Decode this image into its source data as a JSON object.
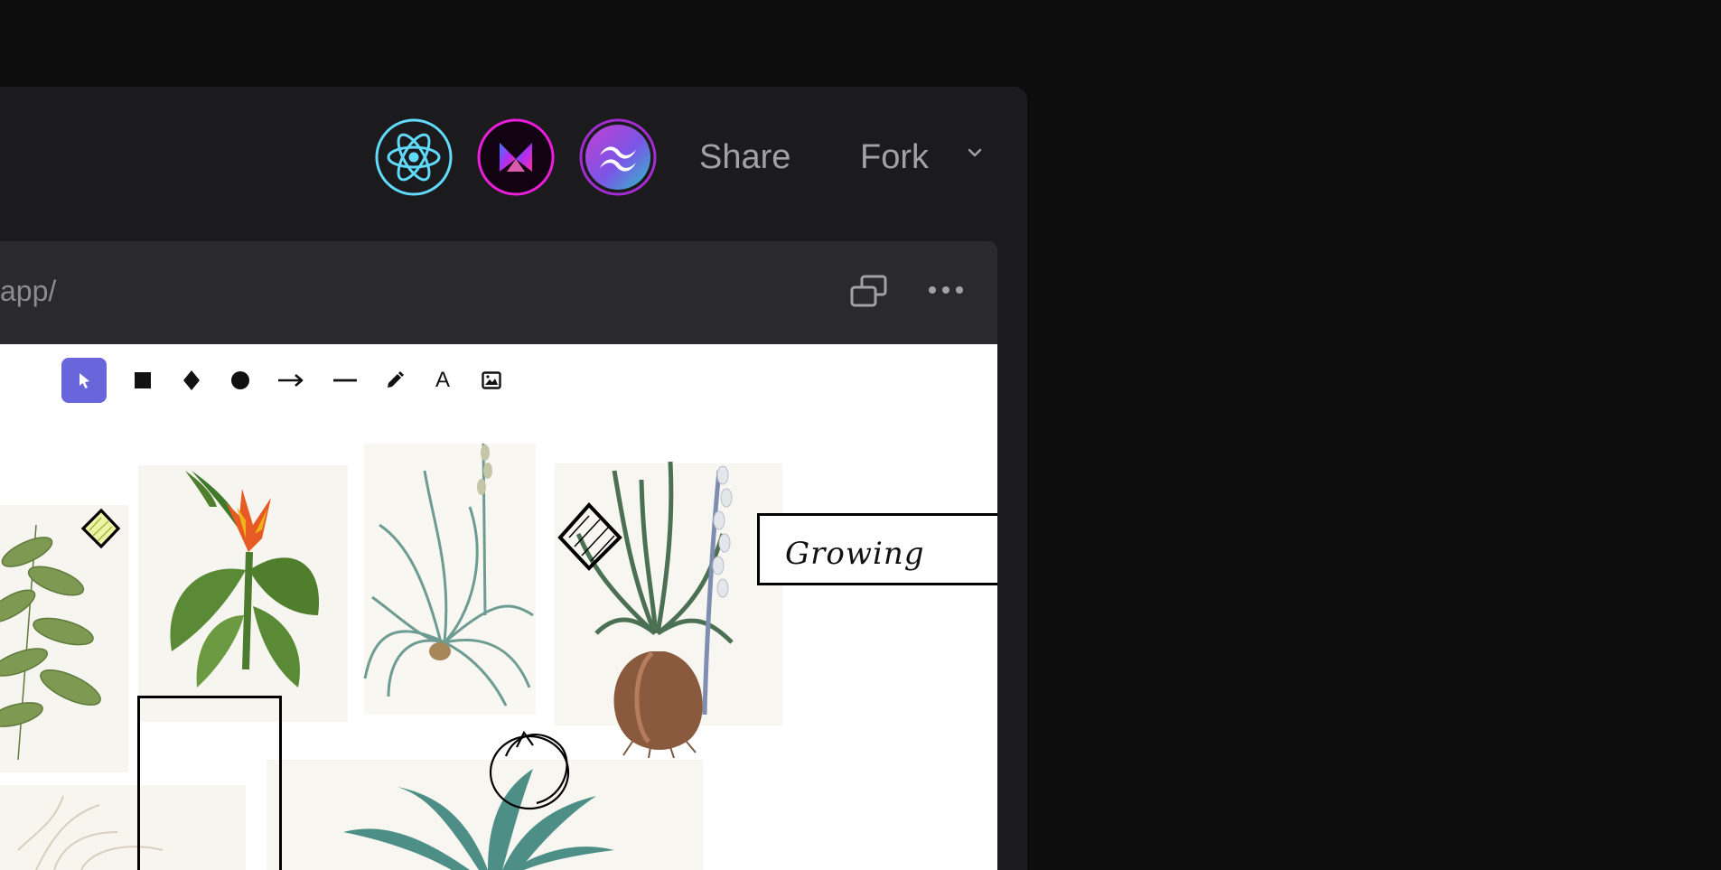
{
  "header": {
    "share_label": "Share",
    "fork_label": "Fork",
    "tech_icons": [
      "react-icon",
      "vite-icon",
      "tailwind-icon"
    ]
  },
  "preview": {
    "url_text": "app/",
    "icons": [
      "open-in-new-window-icon",
      "more-options-icon"
    ]
  },
  "toolbar": {
    "tools": [
      "selection",
      "rectangle",
      "diamond",
      "ellipse",
      "arrow",
      "line",
      "draw",
      "text",
      "image"
    ],
    "text_tool_glyph": "A",
    "active_tool": "selection",
    "accent": "#6965db"
  },
  "canvas": {
    "text_element": "Growing"
  },
  "colors": {
    "background": "#0d0d0e",
    "panel": "#1b1b1d",
    "preview_bar": "#2a2a2c",
    "react": "#61dafb",
    "vite_ring": "#e91ed9",
    "tailwind_ring": "#a32bd3"
  }
}
